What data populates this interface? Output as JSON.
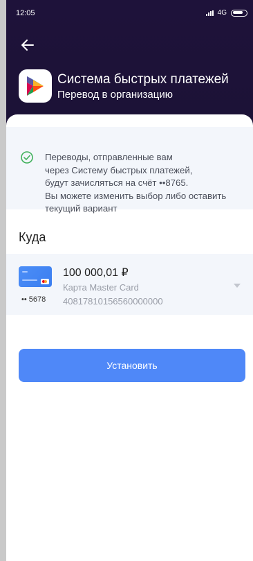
{
  "status": {
    "time": "12:05",
    "network": "4G"
  },
  "header": {
    "title": "Система быстрых платежей",
    "subtitle": "Перевод в организацию"
  },
  "info": {
    "lines": [
      "Переводы, отправленные вам",
      "через Систему быстрых платежей,",
      "будут зачисляться на счёт  ••8765.",
      "Вы можете изменить выбор либо оставить",
      "текущий вариант"
    ]
  },
  "destination": {
    "section_title": "Куда",
    "card_mask": "•• 5678",
    "amount": "100 000,01 ₽",
    "card_name": "Карта Master Card",
    "account": "40817810156560000000"
  },
  "actions": {
    "set_label": "Установить"
  },
  "colors": {
    "header_bg": "#1e123a",
    "accent": "#4f88f8",
    "info_bg": "#f3f6fb",
    "check": "#3fb05a"
  },
  "icons": {
    "back": "arrow-left-icon",
    "logo": "sbp-logo-icon",
    "check": "check-circle-icon",
    "chevron": "chevron-down-icon"
  }
}
